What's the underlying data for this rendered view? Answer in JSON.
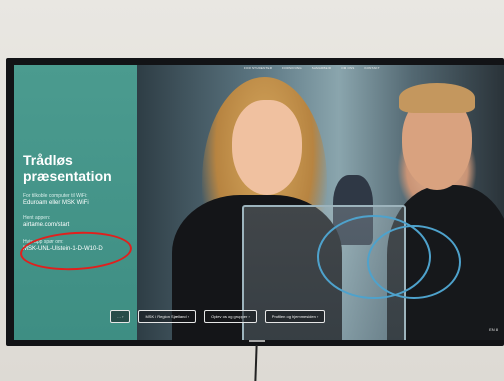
{
  "panel": {
    "title": "Trådløs\npræsentation",
    "line1": "For tilkoble computer til WiFi:",
    "line2": "Eduroam eller MSK WiFi",
    "line3": "Hent appen:",
    "line4": "airtame.com/start",
    "line5": "Hvis app spør om:",
    "line6": "MSK-UNL-Ulstein-1-D-W10-D"
  },
  "topbar": [
    "FOR STUDENTER",
    "FORSKNING",
    "SAMARBEID",
    "OM OSS",
    "KONTAKT"
  ],
  "nav_buttons": [
    "…",
    "MSK i Region Sjælland",
    "Oplev os og grupper",
    "Profilen og hjemmesiden"
  ],
  "corner_text": "EN 8",
  "colors": {
    "panel": "#4b9b8f",
    "highlight": "#e0201d",
    "frame": "#121316"
  }
}
